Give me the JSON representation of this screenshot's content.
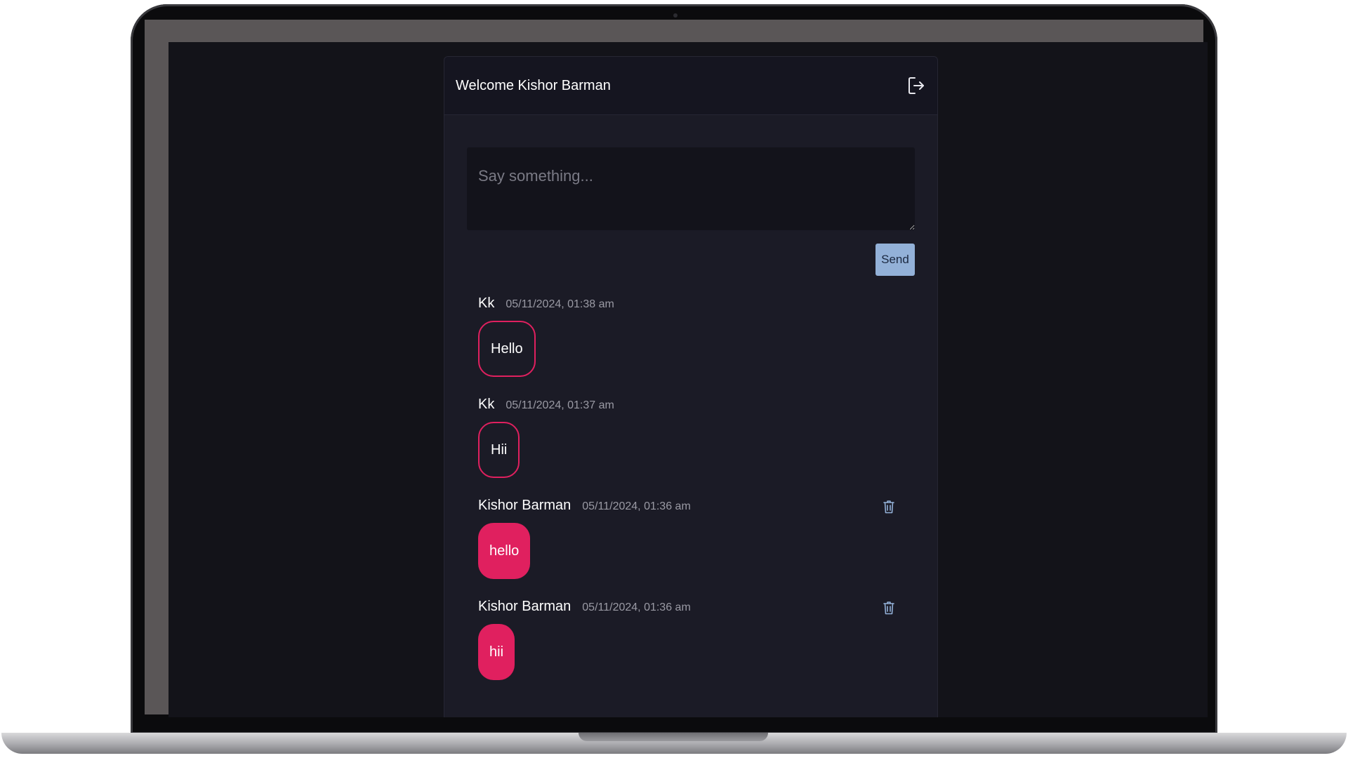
{
  "header": {
    "welcome_text": "Welcome Kishor Barman",
    "logout_icon": "logout-icon"
  },
  "composer": {
    "placeholder": "Say something...",
    "value": "",
    "send_label": "Send"
  },
  "messages": [
    {
      "author": "Kk",
      "time": "05/11/2024, 01:38 am",
      "text": "Hello",
      "own": false
    },
    {
      "author": "Kk",
      "time": "05/11/2024, 01:37 am",
      "text": "Hii",
      "own": false
    },
    {
      "author": "Kishor Barman",
      "time": "05/11/2024, 01:36 am",
      "text": "hello",
      "own": true,
      "action_icon": "trash-icon"
    },
    {
      "author": "Kishor Barman",
      "time": "05/11/2024, 01:36 am",
      "text": "hii",
      "own": true,
      "action_icon": "trash-icon"
    }
  ],
  "colors": {
    "accent": "#e0205f",
    "send_button": "#93b1d8",
    "background": "#131319",
    "card": "#1b1b26"
  }
}
